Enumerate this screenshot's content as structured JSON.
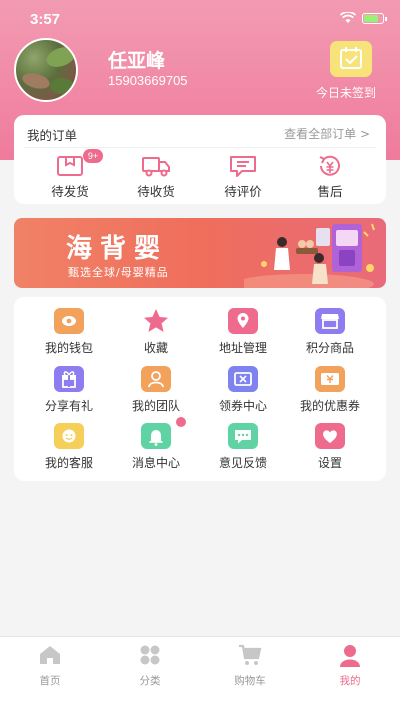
{
  "status_bar": {
    "time": "3:57"
  },
  "profile": {
    "name": "任亚峰",
    "phone": "15903669705",
    "sign_label": "今日未签到"
  },
  "orders": {
    "title": "我的订单",
    "view_all": "查看全部订单 >",
    "items": [
      {
        "label": "待发货",
        "icon": "package-icon",
        "badge": "9+"
      },
      {
        "label": "待收货",
        "icon": "truck-icon"
      },
      {
        "label": "待评价",
        "icon": "comment-icon"
      },
      {
        "label": "售后",
        "icon": "refund-icon"
      }
    ]
  },
  "banner": {
    "title": "海背婴",
    "subtitle": "甄选全球/母婴精品"
  },
  "menu": {
    "items": [
      {
        "label": "我的钱包",
        "icon": "wallet-icon",
        "color": "#f3a25c"
      },
      {
        "label": "收藏",
        "icon": "star-icon",
        "color": "#ee6b8d"
      },
      {
        "label": "地址管理",
        "icon": "location-icon",
        "color": "#ee6b8d"
      },
      {
        "label": "积分商品",
        "icon": "store-icon",
        "color": "#8d7df0"
      },
      {
        "label": "分享有礼",
        "icon": "gift-icon",
        "color": "#8d7df0"
      },
      {
        "label": "我的团队",
        "icon": "team-icon",
        "color": "#f3a25c"
      },
      {
        "label": "领券中心",
        "icon": "ticket-icon",
        "color": "#7f83f0"
      },
      {
        "label": "我的优惠券",
        "icon": "coupon-icon",
        "color": "#f3a25c"
      },
      {
        "label": "我的客服",
        "icon": "service-icon",
        "color": "#f5cf5a"
      },
      {
        "label": "消息中心",
        "icon": "bell-icon",
        "color": "#5fd3a4"
      },
      {
        "label": "意见反馈",
        "icon": "feedback-icon",
        "color": "#5fd3a4"
      },
      {
        "label": "设置",
        "icon": "heart-settings-icon",
        "color": "#ee6b8d"
      }
    ]
  },
  "tabbar": {
    "items": [
      {
        "label": "首页",
        "icon": "home-icon"
      },
      {
        "label": "分类",
        "icon": "category-icon"
      },
      {
        "label": "购物车",
        "icon": "cart-icon"
      },
      {
        "label": "我的",
        "icon": "profile-icon",
        "active": true
      }
    ]
  },
  "colors": {
    "primary": "#ee6b8d",
    "header": "#f07b9c"
  }
}
